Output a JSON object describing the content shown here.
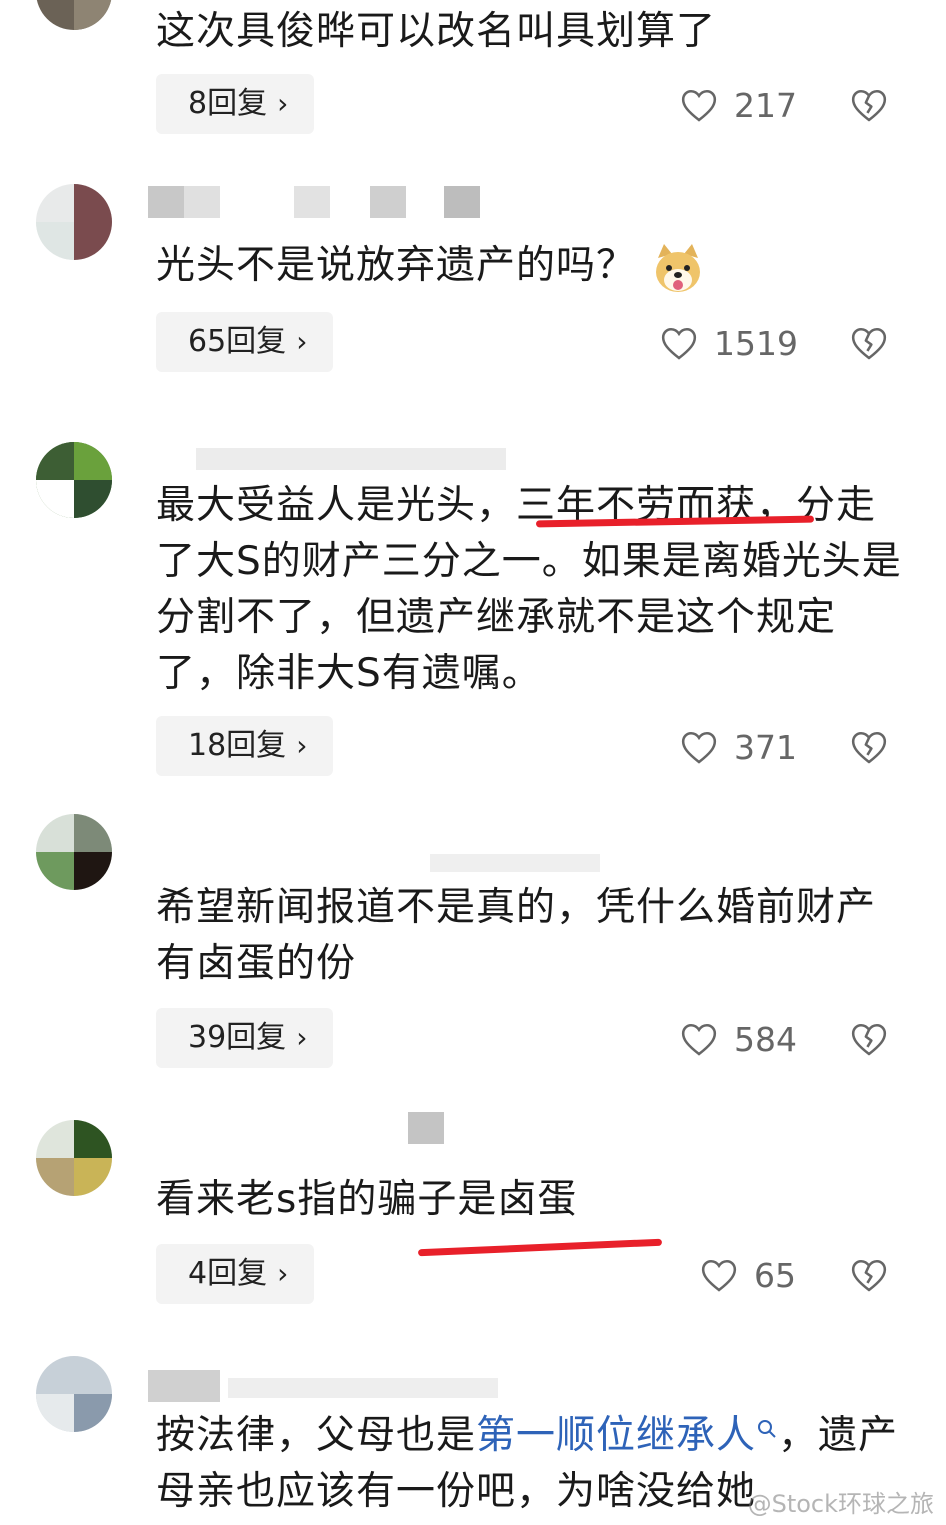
{
  "comments": [
    {
      "text": "这次具俊晔可以改名叫具划算了",
      "replies": "8回复",
      "likes": "217"
    },
    {
      "text": "光头不是说放弃遗产的吗？",
      "replies": "65回复",
      "likes": "1519",
      "emoji": "doge-emoji"
    },
    {
      "text_before": "最大受益人是光头，",
      "text_underlined": "三年不劳而获，",
      "text_after": "分走了大S的财产三分之一。如果是离婚光头是分割不了，但遗产继承就不是这个规定了，除非大S有遗嘱。",
      "replies": "18回复",
      "likes": "371"
    },
    {
      "text": "希望新闻报道不是真的，凭什么婚前财产有卤蛋的份",
      "replies": "39回复",
      "likes": "584"
    },
    {
      "text": "看来老s指的骗子是卤蛋",
      "replies": "4回复",
      "likes": "65"
    },
    {
      "text_before": "按法律，父母也是",
      "link": "第一顺位继承人",
      "text_after": "，遗产母亲也应该有一份吧，为啥没给她"
    }
  ],
  "watermark": "@Stock环球之旅",
  "colors": {
    "accent_underline": "#e8202a",
    "link": "#2e63b8",
    "button_bg": "#f3f3f3"
  }
}
